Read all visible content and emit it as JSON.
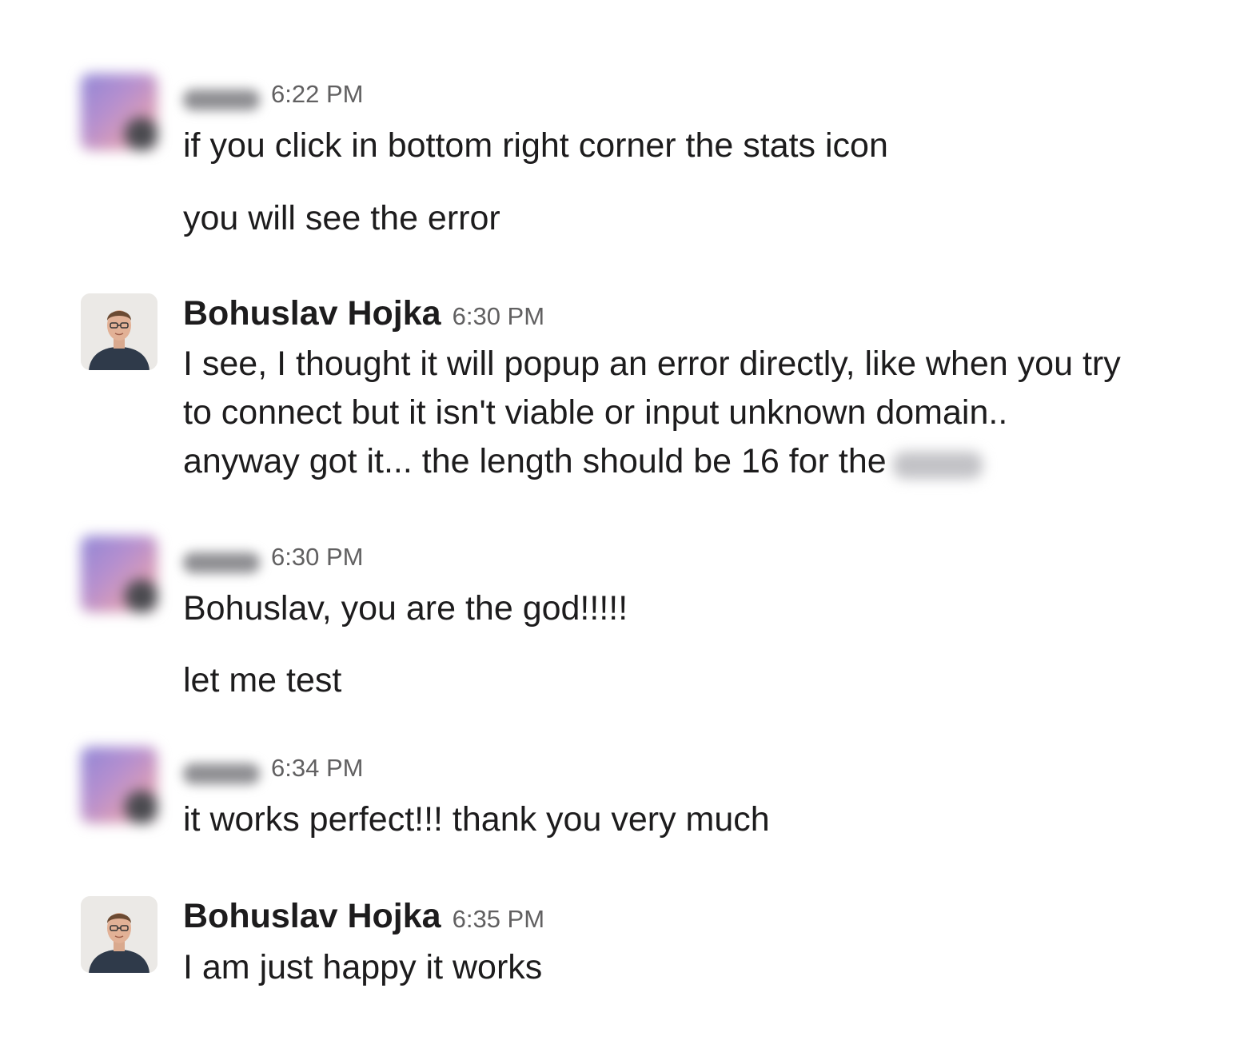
{
  "messages": [
    {
      "sender": "",
      "sender_blurred": true,
      "time": "6:22 PM",
      "lines": [
        "if you click in bottom right corner the stats icon"
      ],
      "followups": [
        "you will see the error"
      ]
    },
    {
      "sender": "Bohuslav Hojka",
      "sender_blurred": false,
      "time": "6:30 PM",
      "lines": [
        "I see, I thought it will popup an error directly, like when you try",
        "to connect but it isn't viable or input unknown domain..",
        "anyway got it... the length should be 16 for the"
      ]
    },
    {
      "sender": "",
      "sender_blurred": true,
      "time": "6:30 PM",
      "lines": [
        "Bohuslav, you are the god!!!!!"
      ],
      "followups": [
        "let me test"
      ]
    },
    {
      "sender": "",
      "sender_blurred": true,
      "time": "6:34 PM",
      "lines": [
        "it works perfect!!! thank you very much"
      ]
    },
    {
      "sender": "Bohuslav Hojka",
      "sender_blurred": false,
      "time": "6:35 PM",
      "lines": [
        "I am just happy it works"
      ]
    }
  ]
}
